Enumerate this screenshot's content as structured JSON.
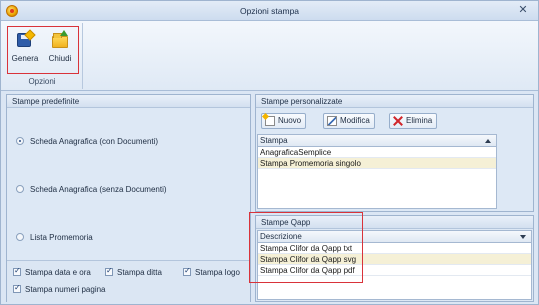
{
  "window": {
    "title": "Opzioni stampa",
    "close_glyph": "✕"
  },
  "ribbon": {
    "group_label": "Opzioni",
    "buttons": [
      {
        "label": "Genera",
        "icon": "generate-icon"
      },
      {
        "label": "Chiudi",
        "icon": "close-folder-icon"
      }
    ]
  },
  "predefined": {
    "header": "Stampe predefinite",
    "options": [
      {
        "label": "Scheda Anagrafica (con Documenti)",
        "selected": true
      },
      {
        "label": "Scheda Anagrafica (senza Documenti)",
        "selected": false
      },
      {
        "label": "Lista Promemoria",
        "selected": false
      }
    ],
    "checkboxes": [
      {
        "label": "Stampa data e ora",
        "checked": true
      },
      {
        "label": "Stampa ditta",
        "checked": true
      },
      {
        "label": "Stampa logo",
        "checked": true
      },
      {
        "label": "Stampa numeri pagina",
        "checked": true
      }
    ]
  },
  "custom": {
    "header": "Stampe personalizzate",
    "toolbar": {
      "new": "Nuovo",
      "edit": "Modifica",
      "delete": "Elimina"
    },
    "column": "Stampa",
    "rows": [
      "AnagraficaSemplice",
      "Stampa Promemoria singolo"
    ]
  },
  "qapp": {
    "header": "Stampe Qapp",
    "column": "Descrizione",
    "rows": [
      "Stampa Clifor da Qapp txt",
      "Stampa Clifor da Qapp svg",
      "Stampa Clifor da Qapp pdf"
    ]
  },
  "colors": {
    "highlight": "#d9333a",
    "selected_row": "#f5f0d6",
    "panel": "#dde8f5"
  }
}
